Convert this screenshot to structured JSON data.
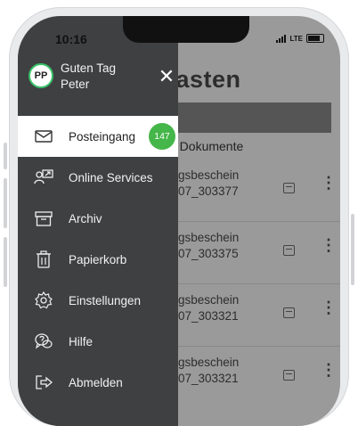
{
  "status": {
    "time": "10:16",
    "network": "LTE"
  },
  "drawer": {
    "avatar_initials": "PP",
    "greeting_line1": "Guten Tag",
    "greeting_line2": "Peter",
    "menu": [
      {
        "label": "Posteingang",
        "icon": "mail-icon",
        "badge": "147"
      },
      {
        "label": "Online Services",
        "icon": "online-services-icon"
      },
      {
        "label": "Archiv",
        "icon": "archive-icon"
      },
      {
        "label": "Papierkorb",
        "icon": "trash-icon"
      },
      {
        "label": "Einstellungen",
        "icon": "gear-icon"
      },
      {
        "label": "Hilfe",
        "icon": "help-icon"
      },
      {
        "label": "Abmelden",
        "icon": "logout-icon"
      }
    ]
  },
  "background": {
    "title": "kasten",
    "section": "e Dokumente",
    "docs": [
      {
        "line1": "gsbeschein",
        "line2": "07_303377"
      },
      {
        "line1": "gsbeschein",
        "line2": "07_303375"
      },
      {
        "line1": "gsbeschein",
        "line2": "07_303321"
      },
      {
        "line1": "gsbeschein",
        "line2": "07_303321"
      }
    ]
  },
  "colors": {
    "drawer_bg": "#3e4041",
    "badge": "#45b649",
    "active_bg": "#ffffff"
  }
}
